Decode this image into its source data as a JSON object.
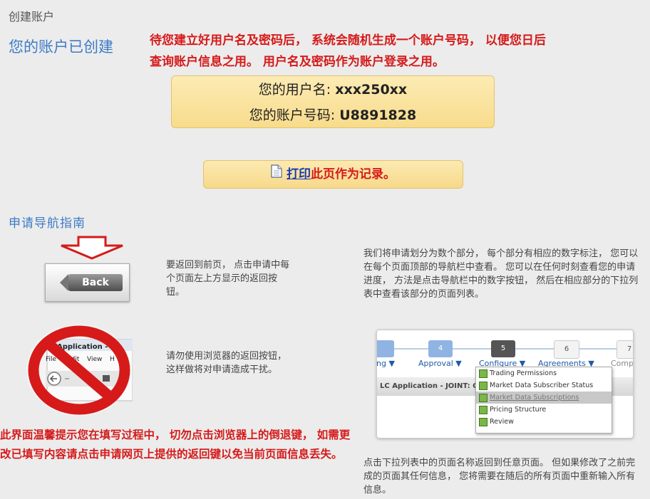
{
  "page": {
    "title": "创建账户",
    "created_heading": "您的账户已创建",
    "info_note": "待您建立好用户名及密码后， 系统会随机生成一个账户号码， 以便您日后查询账户信息之用。 用户名及密码作为账户登录之用。"
  },
  "account": {
    "username_label": "您的用户名: ",
    "username_value": "xxx250xx",
    "account_label": "您的账户号码: ",
    "account_value": "U8891828"
  },
  "print": {
    "link_label": "打印",
    "rest_label": "此页作为记录。",
    "icon": "document-icon"
  },
  "nav_guide": {
    "heading": "申请导航指南",
    "back_tip": "要返回到前页， 点击申请中每个页面左上方显示的返回按钮。",
    "back_button_label": "Back",
    "browser_tip": "请勿使用浏览器的返回按钮， 这样做将对申请造成干扰。",
    "browser_menu": [
      "File",
      "Edit",
      "View",
      "H"
    ],
    "browser_title": "Application -",
    "sections_tip": "我们将申请划分为数个部分， 每个部分有相应的数字标注， 您可以在每个页面顶部的导航栏中查看。 您可以在任何时刻查看您的申请进度， 方法是点击导航栏中的数字按钮， 然后在相应部分的下拉列表中查看该部分的页面列表。",
    "dropdown_tip": "点击下拉列表中的页面名称返回到任意页面。 但如果修改了之前完成的页面其任何信息， 您将需要在随后的所有页面中重新输入所有信息。",
    "warning_note": "此界面温馨提示您在填写过程中， 切勿点击浏览器上的倒退键， 如需更改已填写内容请点击申请网页上提供的返回键以免当前页面信息丢失。"
  },
  "nav_screenshot": {
    "steps": [
      {
        "num": "",
        "label": "ing ▼",
        "color": "#8fb4e3"
      },
      {
        "num": "4",
        "label": "Approval ▼",
        "color": "#8fb4e3"
      },
      {
        "num": "5",
        "label": "Configure ▼",
        "color": "#555555"
      },
      {
        "num": "6",
        "label": "Agreements ▼",
        "color": "#f3f3f3"
      },
      {
        "num": "7",
        "label": "Comp",
        "color": "#f3f3f3"
      }
    ],
    "app_bar": "LC Application - JOINT: C",
    "dropdown_items": [
      "Trading Permissions",
      "Market Data Subscriber Status",
      "Market Data Subscriptions",
      "Pricing Structure",
      "Review"
    ]
  },
  "colors": {
    "accent_blue": "#3d7bc6",
    "warning_red": "#d61a1a",
    "box_yellow": "#f8dc8c"
  }
}
